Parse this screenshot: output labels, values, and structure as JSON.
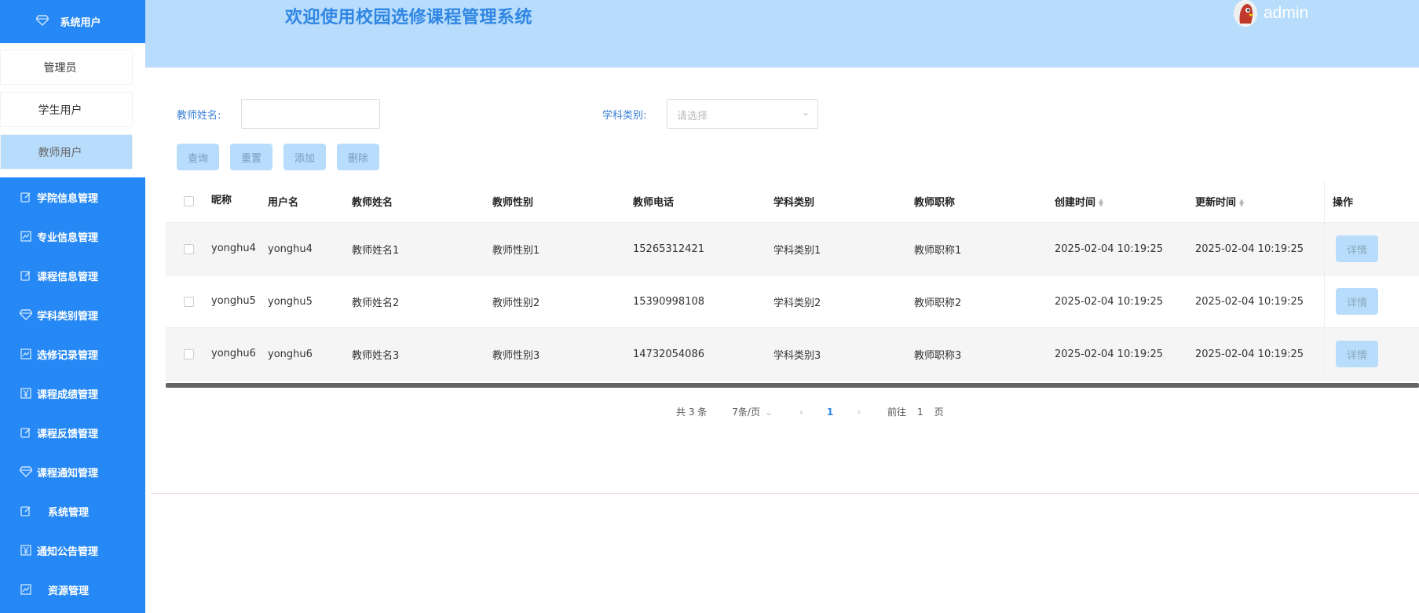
{
  "header": {
    "title": "欢迎使用校园选修课程管理系统",
    "username": "admin"
  },
  "sidebar": {
    "top_item": "系统用户",
    "sub_items": [
      {
        "label": "管理员"
      },
      {
        "label": "学生用户"
      },
      {
        "label": "教师用户",
        "active": true
      }
    ],
    "items": [
      {
        "label": "学院信息管理",
        "icon": "edit-icon"
      },
      {
        "label": "专业信息管理",
        "icon": "chart-icon"
      },
      {
        "label": "课程信息管理",
        "icon": "edit-icon"
      },
      {
        "label": "学科类别管理",
        "icon": "diamond-icon"
      },
      {
        "label": "选修记录管理",
        "icon": "chart-icon"
      },
      {
        "label": "课程成绩管理",
        "icon": "yen-icon"
      },
      {
        "label": "课程反馈管理",
        "icon": "edit-icon"
      },
      {
        "label": "课程通知管理",
        "icon": "diamond-icon"
      },
      {
        "label": "系统管理",
        "icon": "edit-icon"
      },
      {
        "label": "通知公告管理",
        "icon": "yen-icon"
      },
      {
        "label": "资源管理",
        "icon": "chart-icon"
      }
    ]
  },
  "search": {
    "teacher_name_label": "教师姓名:",
    "teacher_name_value": "",
    "category_label": "学科类别:",
    "category_placeholder": "请选择"
  },
  "buttons": {
    "query": "查询",
    "reset": "重置",
    "add": "添加",
    "delete": "删除"
  },
  "table": {
    "columns": [
      "昵称",
      "用户名",
      "教师姓名",
      "教师性别",
      "教师电话",
      "学科类别",
      "教师职称",
      "创建时间",
      "更新时间",
      "操作"
    ],
    "rows": [
      {
        "nickname": "yonghu4",
        "username": "yonghu4",
        "name": "教师姓名1",
        "gender": "教师性别1",
        "phone": "15265312421",
        "category": "学科类别1",
        "title": "教师职称1",
        "created": "2025-02-04 10:19:25",
        "updated": "2025-02-04 10:19:25",
        "action": "详情"
      },
      {
        "nickname": "yonghu5",
        "username": "yonghu5",
        "name": "教师姓名2",
        "gender": "教师性别2",
        "phone": "15390998108",
        "category": "学科类别2",
        "title": "教师职称2",
        "created": "2025-02-04 10:19:25",
        "updated": "2025-02-04 10:19:25",
        "action": "详情"
      },
      {
        "nickname": "yonghu6",
        "username": "yonghu6",
        "name": "教师姓名3",
        "gender": "教师性别3",
        "phone": "14732054086",
        "category": "学科类别3",
        "title": "教师职称3",
        "created": "2025-02-04 10:19:25",
        "updated": "2025-02-04 10:19:25",
        "action": "详情"
      }
    ]
  },
  "pagination": {
    "total": "共 3 条",
    "page_size": "7条/页",
    "current_page": "1",
    "goto_label": "前往",
    "goto_value": "1",
    "page_suffix": "页"
  },
  "colors": {
    "sidebar": "#2588f4",
    "header": "#b8dcfb",
    "title": "#2f86e3",
    "button": "#b8dcfb"
  }
}
